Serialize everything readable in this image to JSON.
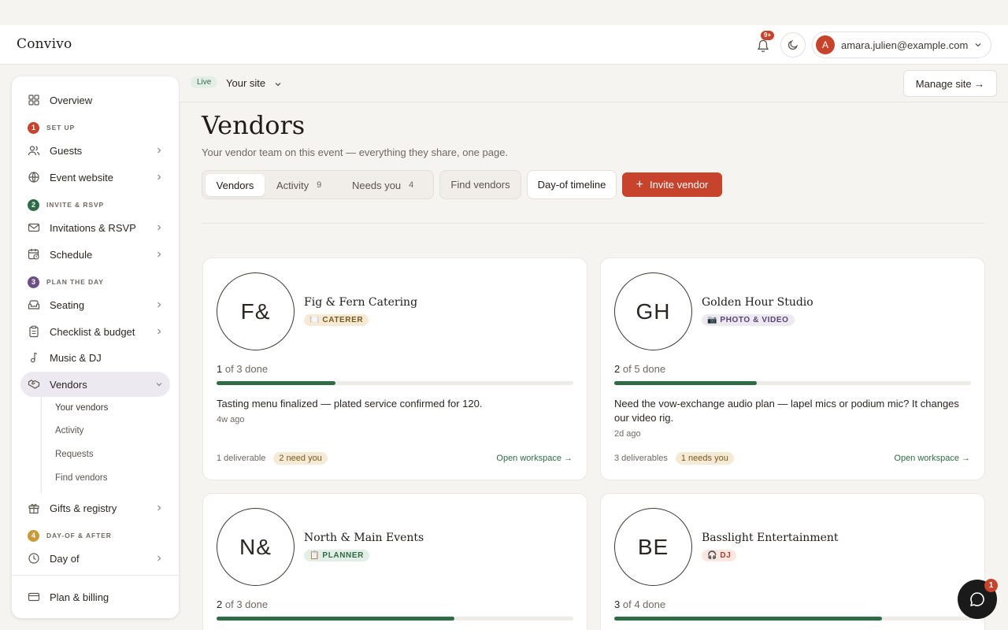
{
  "app": {
    "brand": "Convivo"
  },
  "header": {
    "notification_count": "9+",
    "user_initial": "A",
    "user_email": "amara.julien@example.com"
  },
  "sidebar": {
    "overview": "Overview",
    "sections": [
      {
        "num": "1",
        "label": "SET UP",
        "color": "#c8432b"
      },
      {
        "num": "2",
        "label": "INVITE & RSVP",
        "color": "#2f6b46"
      },
      {
        "num": "3",
        "label": "PLAN THE DAY",
        "color": "#6b4f86"
      },
      {
        "num": "4",
        "label": "DAY-OF & AFTER",
        "color": "#c99a3a"
      }
    ],
    "items": {
      "guests": "Guests",
      "event_website": "Event website",
      "invitations": "Invitations & RSVP",
      "schedule": "Schedule",
      "seating": "Seating",
      "checklist": "Checklist & budget",
      "music": "Music & DJ",
      "vendors": "Vendors",
      "gifts": "Gifts & registry",
      "day_of": "Day of",
      "plan_billing": "Plan & billing"
    },
    "vendor_sub": [
      "Your vendors",
      "Activity",
      "Requests",
      "Find vendors"
    ]
  },
  "sitebar": {
    "status": "Live",
    "site_label": "Your site",
    "manage": "Manage site →"
  },
  "main": {
    "title": "Vendors",
    "subtitle": "Your vendor team on this event — everything they share, one page.",
    "tabs": [
      {
        "label": "Vendors",
        "count": ""
      },
      {
        "label": "Activity",
        "count": "9"
      },
      {
        "label": "Needs you",
        "count": "4"
      }
    ],
    "find_vendors": "Find vendors",
    "day_of_timeline": "Day-of timeline",
    "invite_vendor": "Invite vendor"
  },
  "vendors": [
    {
      "monogram": "F&",
      "name": "Fig & Fern Catering",
      "tag": "🍽️ CATERER",
      "tag_bg": "#f5ead6",
      "tag_color": "#7a5a1c",
      "done": "1",
      "total": "3",
      "progress_fraction": 0.333,
      "message": "Tasting menu finalized — plated service confirmed for 120.",
      "ago": "4w ago",
      "deliverables": "1 deliverable",
      "need_badge": "2 need you",
      "open_label": "Open workspace →"
    },
    {
      "monogram": "GH",
      "name": "Golden Hour Studio",
      "tag": "📷 PHOTO & VIDEO",
      "tag_bg": "#ede9f0",
      "tag_color": "#5b4475",
      "done": "2",
      "total": "5",
      "progress_fraction": 0.4,
      "message": "Need the vow-exchange audio plan — lapel mics or podium mic? It changes our video rig.",
      "ago": "2d ago",
      "deliverables": "3 deliverables",
      "need_badge": "1 needs you",
      "open_label": "Open workspace →"
    },
    {
      "monogram": "N&",
      "name": "North & Main Events",
      "tag": "📋 PLANNER",
      "tag_bg": "#e3eee6",
      "tag_color": "#2f6b46",
      "done": "2",
      "total": "3",
      "progress_fraction": 0.667,
      "message": "",
      "ago": "",
      "deliverables": "",
      "need_badge": "",
      "open_label": ""
    },
    {
      "monogram": "BE",
      "name": "Basslight Entertainment",
      "tag": "🎧 DJ",
      "tag_bg": "#fbe7e2",
      "tag_color": "#a8402b",
      "done": "3",
      "total": "4",
      "progress_fraction": 0.75,
      "message": "",
      "ago": "",
      "deliverables": "",
      "need_badge": "",
      "open_label": ""
    }
  ],
  "chat": {
    "badge": "1"
  }
}
